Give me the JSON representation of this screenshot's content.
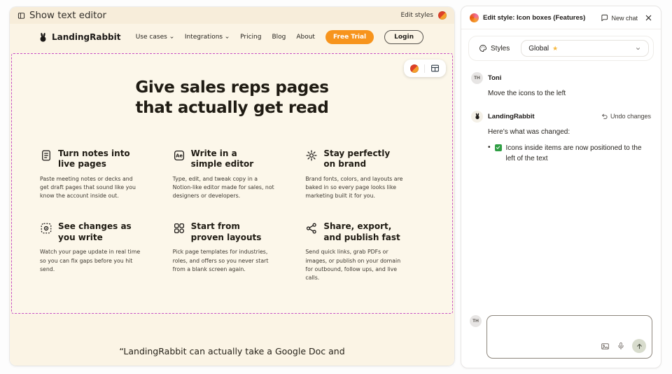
{
  "topbar": {
    "show_text_editor": "Show text editor",
    "edit_styles": "Edit styles"
  },
  "site": {
    "logo": "LandingRabbit",
    "nav": [
      {
        "label": "Use cases"
      },
      {
        "label": "Integrations"
      },
      {
        "label": "Pricing"
      },
      {
        "label": "Blog"
      },
      {
        "label": "About"
      }
    ],
    "free_trial_label": "Free Trial",
    "login_label": "Login",
    "editor_icon_glyph": "Ae",
    "hero": {
      "line1": "Give sales reps pages",
      "line2": "that actually get read"
    },
    "features": [
      {
        "icon": "notes-icon",
        "title": "Turn notes into live pages",
        "desc": "Paste meeting notes or decks and get draft pages that sound like you know the account inside out."
      },
      {
        "icon": "editor-icon",
        "title": "Write in a simple editor",
        "desc": "Type, edit, and tweak copy in a Notion-like editor made for sales, not designers or developers."
      },
      {
        "icon": "brand-icon",
        "title": "Stay perfectly on brand",
        "desc": "Brand fonts, colors, and layouts are baked in so every page looks like marketing built it for you."
      },
      {
        "icon": "preview-icon",
        "title": "See changes as you write",
        "desc": "Watch your page update in real time so you can fix gaps before you hit send."
      },
      {
        "icon": "layouts-icon",
        "title": "Start from proven layouts",
        "desc": "Pick page templates for industries, roles, and offers so you never start from a blank screen again."
      },
      {
        "icon": "share-icon",
        "title": "Share, export, and publish fast",
        "desc": "Send quick links, grab PDFs or images, or publish on your domain for outbound, follow ups, and live calls."
      }
    ],
    "testimonial": "“LandingRabbit can actually take a Google Doc and"
  },
  "panel": {
    "title": "Edit style: Icon boxes (Features)",
    "new_chat_label": "New chat",
    "styles_label": "Styles",
    "scope_value": "Global",
    "user": {
      "initials": "TH",
      "name": "Toni"
    },
    "assistant": {
      "name": "LandingRabbit",
      "undo_label": "Undo changes"
    },
    "message_user": "Move the icons to the left",
    "message_intro": "Here’s what was changed:",
    "message_bullet": "Icons inside items are now positioned to the left of the text"
  },
  "colors": {
    "accent_orange": "#f7941d",
    "selection_magenta": "#c74fc2",
    "cream_background": "#fbf4e5",
    "check_green": "#2f9e44"
  }
}
